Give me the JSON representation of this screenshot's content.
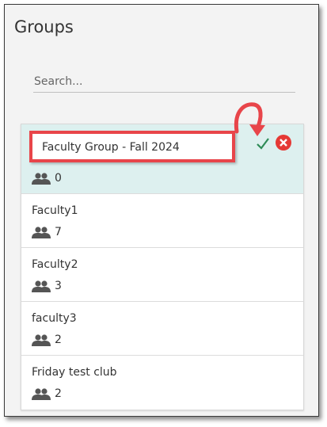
{
  "panel": {
    "title": "Groups"
  },
  "search": {
    "placeholder": "Search..."
  },
  "groups": [
    {
      "name": "Faculty Group - Fall 2024",
      "members": "0",
      "editing": true
    },
    {
      "name": "Faculty1",
      "members": "7"
    },
    {
      "name": "Faculty2",
      "members": "3"
    },
    {
      "name": "faculty3",
      "members": "2"
    },
    {
      "name": "Friday test club",
      "members": "2"
    }
  ],
  "colors": {
    "highlight": "#e8454a",
    "confirm": "#2e8b57",
    "cancel": "#e53935",
    "editing_row": "#ddf0ef"
  },
  "icons": {
    "members": "people-icon",
    "confirm": "checkmark-icon",
    "cancel": "close-circle-icon"
  }
}
